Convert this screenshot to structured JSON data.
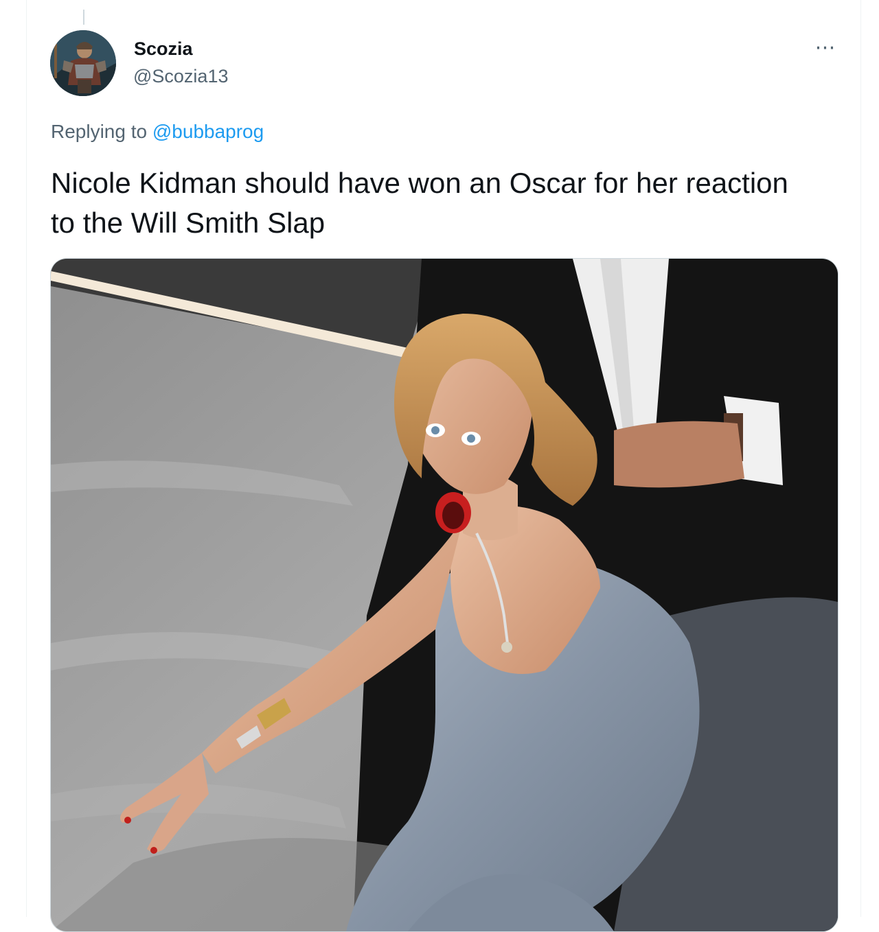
{
  "tweet": {
    "author": {
      "display_name": "Scozia",
      "handle": "@Scozia13"
    },
    "reply_context": {
      "prefix": "Replying to",
      "mention": "@bubbaprog"
    },
    "text": "Nicole Kidman should have won an Oscar for her reaction to the Will Smith Slap",
    "more_icon": "⋯"
  },
  "icons": {
    "more": "more-horizontal-icon"
  }
}
